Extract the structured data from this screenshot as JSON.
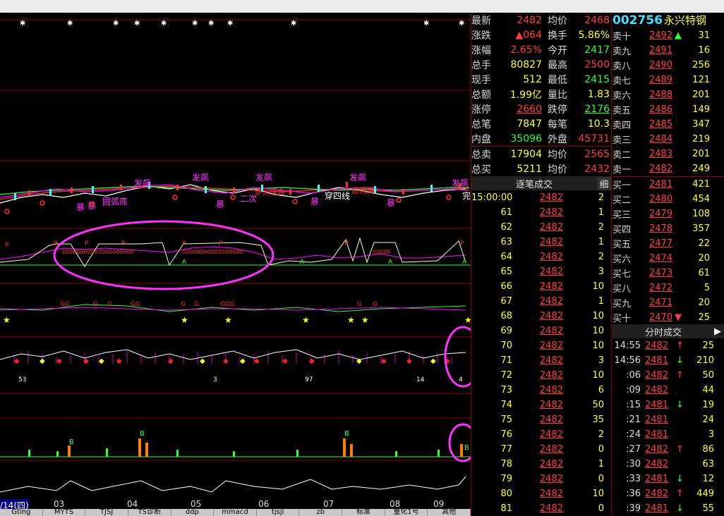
{
  "stock": {
    "code": "002756",
    "name": "永兴特钢"
  },
  "quote": [
    {
      "l": "最新",
      "v": "2482",
      "vc": "red",
      "r": "均价",
      "v2": "2468",
      "v2c": "red"
    },
    {
      "l": "涨跌",
      "v": "▲064",
      "vc": "red",
      "r": "换手",
      "v2": "5.86%",
      "v2c": "yellow"
    },
    {
      "l": "涨幅",
      "v": "2.65%",
      "vc": "red",
      "r": "今开",
      "v2": "2417",
      "v2c": "green"
    },
    {
      "l": "总手",
      "v": "80827",
      "vc": "yellow",
      "r": "最高",
      "v2": "2500",
      "v2c": "red"
    },
    {
      "l": "现手",
      "v": "512",
      "vc": "yellow",
      "r": "最低",
      "v2": "2415",
      "v2c": "green"
    },
    {
      "l": "总额",
      "v": "1.99亿",
      "vc": "yellow",
      "r": "量比",
      "v2": "1.83",
      "v2c": "yellow"
    },
    {
      "l": "涨停",
      "v": "2660",
      "vc": "red",
      "r": "跌停",
      "v2": "2176",
      "v2c": "green"
    },
    {
      "l": "总笔",
      "v": "7847",
      "vc": "yellow",
      "r": "每笔",
      "v2": "10.3",
      "v2c": "yellow"
    },
    {
      "l": "内盘",
      "v": "35096",
      "vc": "green",
      "r": "外盘",
      "v2": "45731",
      "v2c": "red"
    },
    {
      "l": "总卖",
      "v": "17904",
      "vc": "yellow",
      "r": "均价",
      "v2": "2565",
      "v2c": "red"
    },
    {
      "l": "总买",
      "v": "5211",
      "vc": "yellow",
      "r": "均价",
      "v2": "2432",
      "v2c": "red"
    }
  ],
  "ticks_header": {
    "title": "逐笔成交",
    "detail": "细"
  },
  "ticks": [
    {
      "t": "15:00:00",
      "p": "2482",
      "v": "2"
    },
    {
      "t": "61",
      "p": "2482",
      "v": "1"
    },
    {
      "t": "62",
      "p": "2482",
      "v": "2"
    },
    {
      "t": "63",
      "p": "2482",
      "v": "1"
    },
    {
      "t": "64",
      "p": "2482",
      "v": "2"
    },
    {
      "t": "65",
      "p": "2482",
      "v": "3"
    },
    {
      "t": "66",
      "p": "2482",
      "v": "10"
    },
    {
      "t": "67",
      "p": "2482",
      "v": "1"
    },
    {
      "t": "68",
      "p": "2482",
      "v": "10"
    },
    {
      "t": "69",
      "p": "2482",
      "v": "10"
    },
    {
      "t": "70",
      "p": "2482",
      "v": "10"
    },
    {
      "t": "71",
      "p": "2482",
      "v": "3"
    },
    {
      "t": "72",
      "p": "2482",
      "v": "10"
    },
    {
      "t": "73",
      "p": "2482",
      "v": "6"
    },
    {
      "t": "74",
      "p": "2482",
      "v": "50"
    },
    {
      "t": "75",
      "p": "2482",
      "v": "35"
    },
    {
      "t": "76",
      "p": "2482",
      "v": "2"
    },
    {
      "t": "77",
      "p": "2482",
      "v": "0"
    },
    {
      "t": "78",
      "p": "2482",
      "v": "1"
    },
    {
      "t": "79",
      "p": "2482",
      "v": "0"
    },
    {
      "t": "80",
      "p": "2482",
      "v": "10"
    },
    {
      "t": "81",
      "p": "2482",
      "v": "0"
    }
  ],
  "book": [
    {
      "l": "卖十",
      "p": "2492",
      "a": "▲",
      "ac": "green",
      "v": "31"
    },
    {
      "l": "卖九",
      "p": "2491",
      "a": "",
      "ac": "",
      "v": "16"
    },
    {
      "l": "卖八",
      "p": "2490",
      "a": "",
      "ac": "",
      "v": "256"
    },
    {
      "l": "卖七",
      "p": "2489",
      "a": "",
      "ac": "",
      "v": "121"
    },
    {
      "l": "卖六",
      "p": "2488",
      "a": "",
      "ac": "",
      "v": "201"
    },
    {
      "l": "卖五",
      "p": "2486",
      "a": "",
      "ac": "",
      "v": "149"
    },
    {
      "l": "卖四",
      "p": "2485",
      "a": "",
      "ac": "",
      "v": "347"
    },
    {
      "l": "卖三",
      "p": "2484",
      "a": "",
      "ac": "",
      "v": "219"
    },
    {
      "l": "卖二",
      "p": "2483",
      "a": "",
      "ac": "",
      "v": "201"
    },
    {
      "l": "卖一",
      "p": "2482",
      "a": "",
      "ac": "",
      "v": "249"
    },
    {
      "l": "买一",
      "p": "2481",
      "a": "",
      "ac": "",
      "v": "421"
    },
    {
      "l": "买二",
      "p": "2480",
      "a": "",
      "ac": "",
      "v": "454"
    },
    {
      "l": "买三",
      "p": "2479",
      "a": "",
      "ac": "",
      "v": "108"
    },
    {
      "l": "买四",
      "p": "2478",
      "a": "",
      "ac": "",
      "v": "357"
    },
    {
      "l": "买五",
      "p": "2477",
      "a": "",
      "ac": "",
      "v": "22"
    },
    {
      "l": "买六",
      "p": "2474",
      "a": "",
      "ac": "",
      "v": "20"
    },
    {
      "l": "买七",
      "p": "2473",
      "a": "",
      "ac": "",
      "v": "61"
    },
    {
      "l": "买八",
      "p": "2472",
      "a": "",
      "ac": "",
      "v": "5"
    },
    {
      "l": "买九",
      "p": "2471",
      "a": "",
      "ac": "",
      "v": "20"
    },
    {
      "l": "买十",
      "p": "2470",
      "a": "▼",
      "ac": "red",
      "v": "25"
    }
  ],
  "fs_header": {
    "title": "分时成交"
  },
  "fs": [
    {
      "t": "14:55",
      "p": "2482",
      "a": "↑",
      "ac": "red",
      "v": "25"
    },
    {
      "t": "14:56",
      "p": "2481",
      "a": "↓",
      "ac": "green",
      "v": "210"
    },
    {
      "t": ":06",
      "p": "2482",
      "a": "↑",
      "ac": "red",
      "v": "50"
    },
    {
      "t": ":09",
      "p": "2482",
      "a": "",
      "ac": "",
      "v": "44"
    },
    {
      "t": ":15",
      "p": "2481",
      "a": "↓",
      "ac": "green",
      "v": "19"
    },
    {
      "t": ":21",
      "p": "2481",
      "a": "",
      "ac": "",
      "v": "24"
    },
    {
      "t": ":24",
      "p": "2481",
      "a": "",
      "ac": "",
      "v": "3"
    },
    {
      "t": ":27",
      "p": "2482",
      "a": "↑",
      "ac": "red",
      "v": "86"
    },
    {
      "t": ":30",
      "p": "2482",
      "a": "",
      "ac": "",
      "v": "63"
    },
    {
      "t": ":33",
      "p": "2481",
      "a": "↓",
      "ac": "green",
      "v": "12"
    },
    {
      "t": ":36",
      "p": "2482",
      "a": "↑",
      "ac": "red",
      "v": "449"
    },
    {
      "t": ":39",
      "p": "2481",
      "a": "↓",
      "ac": "green",
      "v": "55"
    }
  ],
  "dates": [
    "/14(四)",
    "03",
    "04",
    "05",
    "06",
    "07",
    "08",
    "09"
  ],
  "tabs": [
    "Gting",
    "MYTS",
    "TJSJ",
    "TS诊断",
    "ddp",
    "mmacd",
    "tjsjl",
    "zb",
    "标准",
    "量化1号",
    "其他"
  ],
  "chart_text": [
    "发飙",
    "发飙",
    "发飙",
    "发飙",
    "发飙",
    "暴",
    "暴",
    "暴",
    "暴",
    "暴",
    "暴",
    "圆弧底",
    "二次",
    "穿四线",
    "底背离",
    "多头组合",
    "53",
    "97",
    "3",
    "14",
    "4",
    "P",
    "A",
    "B",
    "G"
  ]
}
